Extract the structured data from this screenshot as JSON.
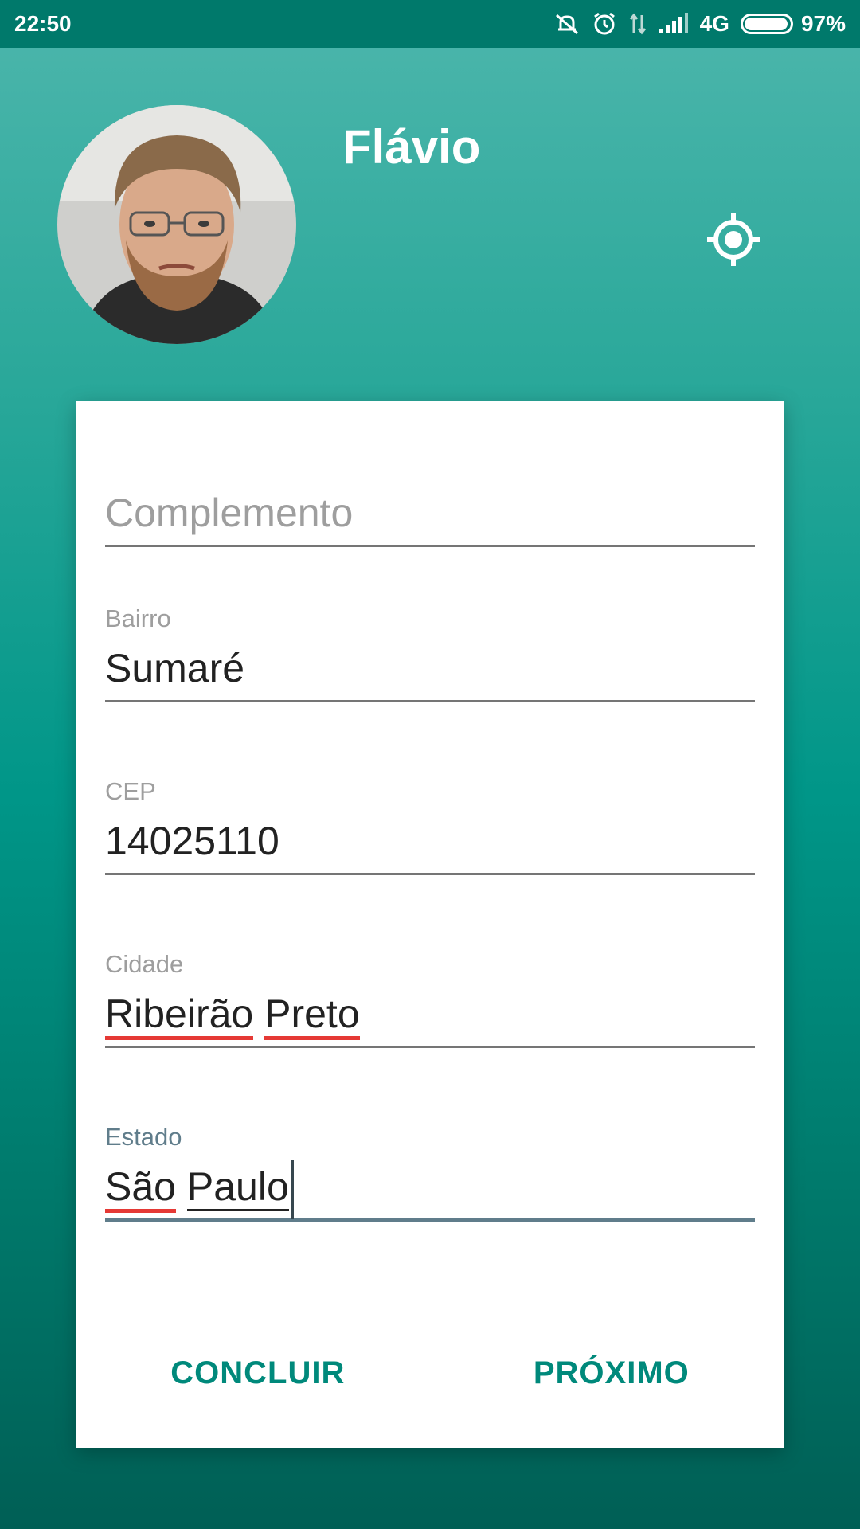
{
  "status_bar": {
    "time": "22:50",
    "network": "4G",
    "battery": "97%",
    "battery_level": 0.97,
    "icons": [
      "mute-icon",
      "alarm-icon",
      "data-arrows-icon",
      "signal-icon",
      "battery-icon"
    ]
  },
  "profile": {
    "name": "Flávio",
    "locate_icon": "gps-target-icon"
  },
  "form": {
    "complemento": {
      "placeholder": "Complemento",
      "value": ""
    },
    "bairro": {
      "label": "Bairro",
      "value": "Sumaré"
    },
    "cep": {
      "label": "CEP",
      "value": "14025110"
    },
    "cidade": {
      "label": "Cidade",
      "value_word1": "Ribeirão",
      "value_word2": "Preto"
    },
    "estado": {
      "label": "Estado",
      "value_word1": "São",
      "value_word2": "Paulo"
    }
  },
  "actions": {
    "finish": "CONCLUIR",
    "next": "PRÓXIMO"
  },
  "colors": {
    "primary": "#009688",
    "accent_text": "#00897b",
    "active_field": "#607d8b",
    "spell_error": "#e53935"
  }
}
